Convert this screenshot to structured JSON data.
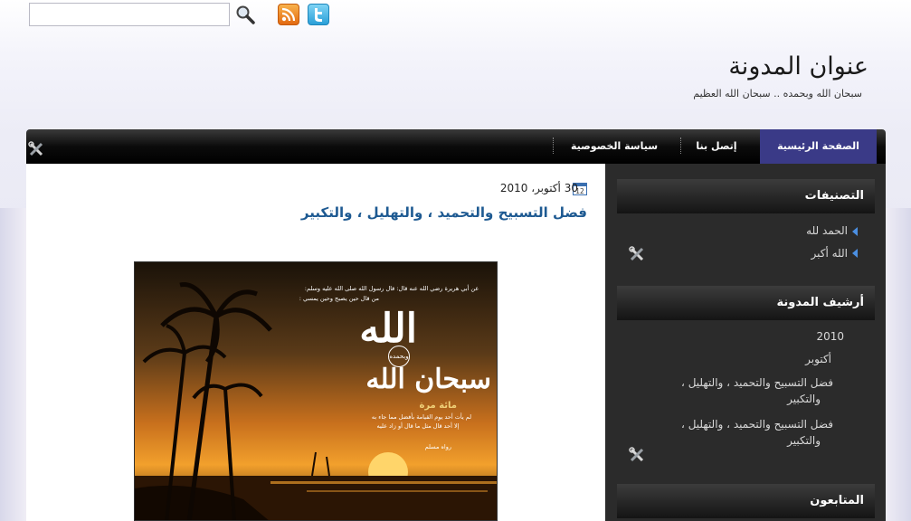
{
  "search": {
    "value": "",
    "placeholder": ""
  },
  "header": {
    "title": "عنوان المدونة",
    "description": "سبحان الله وبحمده .. سبحان الله العظيم"
  },
  "nav": {
    "items": [
      {
        "label": "الصفحة الرئيسية"
      },
      {
        "label": "إتصل بنا"
      },
      {
        "label": "سياسة الخصوصية"
      }
    ]
  },
  "post": {
    "date": "30 أكتوبر، 2010",
    "title": "فضل التسبيح والتحميد ، والتهليل ، والتكبير",
    "image_text": {
      "hadith": "عن أبي هريرة رضي الله عنه قال: قال رسول الله صلى الله عليه وسلم:",
      "hadith2": "من قال حين يصبح وحين يمسي :",
      "big1": "الله",
      "wabihamdih": "وبحمده",
      "big2": "سبحان الله",
      "count": "مائة مرة",
      "line1": "لم يأت أحد يوم القيامة بأفضل مما جاء به",
      "line2": "إلا أحد قال مثل ما قال أو زاد عليه",
      "source": "رواه مسلم"
    }
  },
  "sidebar": {
    "categories": {
      "heading": "التصنيفات",
      "items": [
        "الحمد لله",
        "الله أكبر"
      ]
    },
    "archive": {
      "heading": "أرشيف المدونة",
      "year": "2010",
      "month": "أكتوبر",
      "posts": [
        {
          "line1": "فضل التسبيح والتحميد ، والتهليل ،",
          "line2": "والتكبير"
        },
        {
          "line1": "فضل التسبيح والتحميد ، والتهليل ،",
          "line2": "والتكبير"
        }
      ]
    },
    "followers": {
      "heading": "المتابعون"
    }
  }
}
